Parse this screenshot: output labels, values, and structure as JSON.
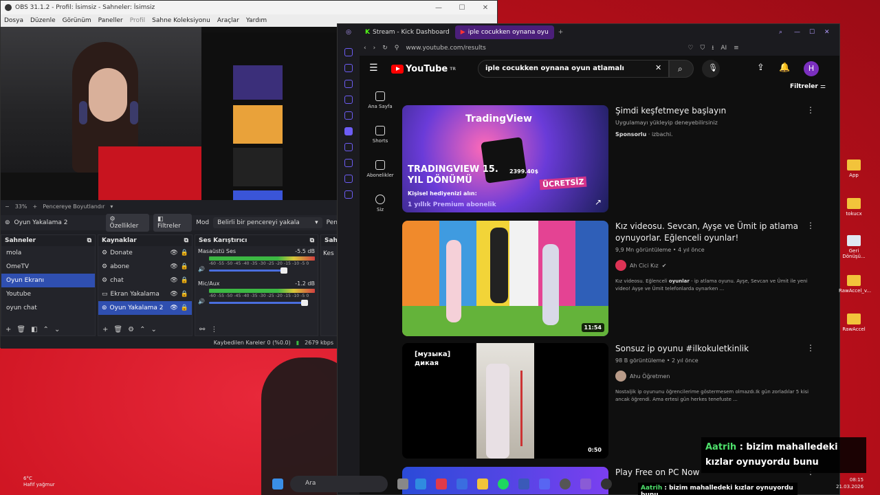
{
  "obs": {
    "title": "OBS 31.1.2 - Profil: İsimsiz - Sahneler: İsimsiz",
    "menu": [
      "Dosya",
      "Düzenle",
      "Görünüm",
      "Paneller",
      "Profil",
      "Sahne Koleksiyonu",
      "Araçlar",
      "Yardım"
    ],
    "zoom": "33%",
    "zoom_mode": "Pencereye Boyutlandır",
    "source_selected": "Oyun Yakalama 2",
    "btn_properties": "Özellikler",
    "btn_filters": "Filtreler",
    "mode_label": "Mod",
    "mode_value": "Belirli bir pencereyi yakala",
    "mode_trunc": "Pen",
    "scenes_header": "Sahneler",
    "scenes": [
      "mola",
      "OmeTV",
      "Oyun Ekranı",
      "Youtube",
      "oyun chat"
    ],
    "selected_scene": "Oyun Ekranı",
    "sources_header": "Kaynaklar",
    "sources": [
      "Donate",
      "abone",
      "chat",
      "Ekran Yakalama",
      "Oyun Yakalama 2"
    ],
    "mixer_header": "Ses Karıştırıcı",
    "mixer": [
      {
        "name": "Masaüstü Ses",
        "db": "-5.5 dB"
      },
      {
        "name": "Mic/Aux",
        "db": "-1.2 dB"
      }
    ],
    "meter_scale": "-60 -55 -50 -45 -40 -35 -30 -25 -20 -15 -10 -5 0",
    "transitions_header": "Sahn",
    "transitions_trunc": "Kes",
    "status_dropped": "Kaybedilen Kareler 0 (%0.0)",
    "status_bitrate": "2679 kbps"
  },
  "browser": {
    "tabs": [
      {
        "label": "Stream - Kick Dashboard"
      },
      {
        "label": "iple cocukken oynana oyu"
      }
    ],
    "url": "www.youtube.com/results",
    "ai_label": "AI"
  },
  "youtube": {
    "logo": "YouTube",
    "logo_region": "TR",
    "search_query": "iple cocukken oynana oyun atlamalı",
    "nav": [
      {
        "label": "Ana Sayfa",
        "icon": "home-icon"
      },
      {
        "label": "Shorts",
        "icon": "shorts-icon"
      },
      {
        "label": "Abonelikler",
        "icon": "subscriptions-icon"
      },
      {
        "label": "Siz",
        "icon": "profile-icon"
      }
    ],
    "filters_label": "Filtreler",
    "avatar_letter": "H",
    "results": [
      {
        "title": "Şimdi keşfetmeye başlayın",
        "meta": "Uygulamayı yükleyip deneyebilirsiniz",
        "sponsor": "Sponsorlu",
        "sponsor_domain": "· izbachi.",
        "thumb": {
          "brand": "TradingView",
          "headline": "TRADINGVIEW 15. YIL DÖNÜMÜ",
          "line1": "Kişisel hediyenizi alın:",
          "line2": "1 yıllık Premium abonelik",
          "price": "2399.40$",
          "badge": "ÜCRETSİZ"
        }
      },
      {
        "title": "Kız videosu. Sevcan, Ayşe ve Ümit ip atlama oynuyorlar. Eğlenceli oyunlar!",
        "meta": "9,9 Mn görüntüleme • 4 yıl önce",
        "channel": "Ah Cici Kız",
        "desc_pre": "Kız videosu. Eğlenceli ",
        "desc_bold": "oyunlar",
        "desc_post": " - ip atlama oyunu. Ayşe, Sevcan ve Ümit ile yeni video! Ayşe ve Ümit telefonlarda oynarken ...",
        "duration": "11:54"
      },
      {
        "title": "Sonsuz ip oyunu #ilkokuletkinlik",
        "meta": "98 B görüntüleme • 2 yıl önce",
        "channel": "Ahu Öğretmen",
        "desc": "Nostaljik ip oyununu öğrencilerime göstermesem olmazdı.Ik gün zorladılar 5 kisi ancak öğrendi. Ama ertesi gün herkes tenefuste ...",
        "thumb_label": "[музыка] дикая",
        "duration": "0:50"
      },
      {
        "title": "Play Free on PC Now"
      }
    ]
  },
  "desktop": {
    "icons": [
      "App",
      "tokucx",
      "Geri Dönüşü...",
      "RawAccel_v...",
      "RawAccel"
    ]
  },
  "chat": {
    "user": "Aatrih",
    "message": " : bizim mahalledeki kızlar oynuyordu bunu"
  },
  "taskbar": {
    "search_placeholder": "Ara",
    "weather_temp": "6°C",
    "weather_desc": "Hafif yağmur",
    "time": "08:15",
    "date": "21.03.2026"
  }
}
